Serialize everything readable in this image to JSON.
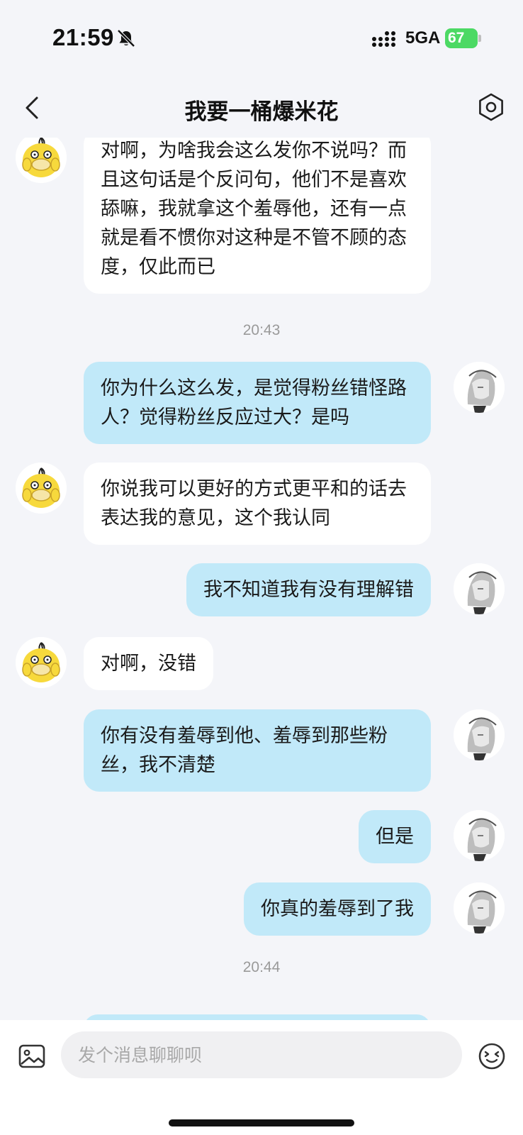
{
  "status_bar": {
    "time": "21:59",
    "network": "5GA",
    "battery": "67",
    "icons": [
      "bell-slash-icon",
      "signal-icon",
      "battery-charging-icon"
    ]
  },
  "header": {
    "title": "我要一桶爆米花",
    "icons": [
      "chevron-left-icon",
      "settings-icon"
    ]
  },
  "messages": [
    {
      "side": "in",
      "text": "对啊，为啥我会这么发你不说吗？而且这句话是个反问句，他们不是喜欢舔嘛，我就拿这个羞辱他，还有一点就是看不惯你对这种是不管不顾的态度，仅此而已"
    },
    {
      "side": "time",
      "text": "20:43"
    },
    {
      "side": "out",
      "text": "你为什么这么发，是觉得粉丝错怪路人？觉得粉丝反应过大？是吗"
    },
    {
      "side": "in",
      "text": "你说我可以更好的方式更平和的话去表达我的意见，这个我认同"
    },
    {
      "side": "out",
      "text": "我不知道我有没有理解错"
    },
    {
      "side": "in",
      "text": "对啊，没错"
    },
    {
      "side": "out",
      "text": "你有没有羞辱到他、羞辱到那些粉丝，我不清楚"
    },
    {
      "side": "out",
      "text": "但是"
    },
    {
      "side": "out",
      "text": "你真的羞辱到了我"
    },
    {
      "side": "time",
      "text": "20:44"
    }
  ],
  "input": {
    "placeholder": "发个消息聊聊呗",
    "value": "",
    "icons": [
      "image-icon",
      "emoji-icon"
    ]
  },
  "colors": {
    "background": "#f4f5f9",
    "incoming_bubble": "#ffffff",
    "outgoing_bubble": "#c1e9f9",
    "battery": "#4cd964"
  }
}
